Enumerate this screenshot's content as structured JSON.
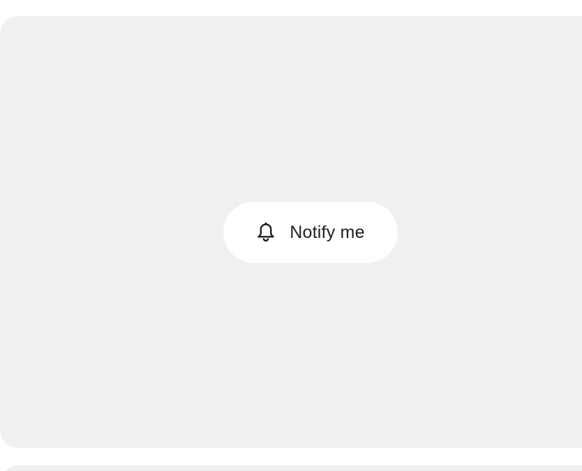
{
  "notify_button": {
    "label": "Notify me",
    "icon": "bell-icon"
  },
  "colors": {
    "page_background": "#ffffff",
    "panel_background": "#f0f0f0",
    "button_background": "#ffffff",
    "text": "#1f1f1f"
  }
}
